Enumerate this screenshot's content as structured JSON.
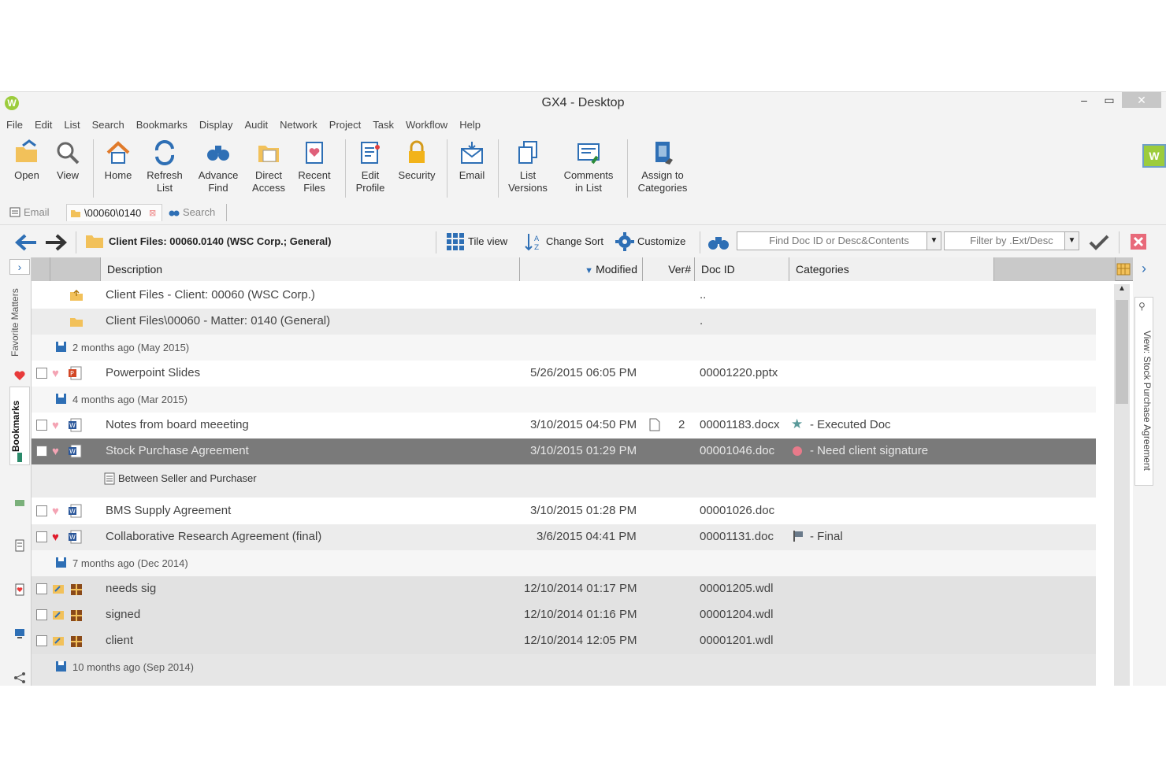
{
  "window": {
    "title": "GX4 - Desktop",
    "minimize": "‒",
    "maximize": "▭",
    "close": "✕"
  },
  "menu": [
    "File",
    "Edit",
    "List",
    "Search",
    "Bookmarks",
    "Display",
    "Audit",
    "Network",
    "Project",
    "Task",
    "Workflow",
    "Help"
  ],
  "ribbon": {
    "open": "Open",
    "view": "View",
    "home": "Home",
    "refresh_1": "Refresh",
    "refresh_2": "List",
    "advance_1": "Advance",
    "advance_2": "Find",
    "direct_1": "Direct",
    "direct_2": "Access",
    "recent_1": "Recent",
    "recent_2": "Files",
    "editprofile_1": "Edit",
    "editprofile_2": "Profile",
    "security": "Security",
    "email": "Email",
    "listversions_1": "List",
    "listversions_2": "Versions",
    "comments_1": "Comments",
    "comments_2": "in List",
    "assign_1": "Assign to",
    "assign_2": "Categories"
  },
  "tabs": {
    "email": "Email",
    "folder": "\\00060\\0140",
    "search": "Search"
  },
  "navbar": {
    "breadcrumb": "Client Files: 00060.0140 (WSC Corp.; General)",
    "tile_view": "Tile view",
    "change_sort": "Change Sort",
    "customize": "Customize",
    "find_placeholder": "Find Doc ID or Desc&Contents",
    "filter_placeholder": "Filter by .Ext/Desc"
  },
  "left_tabs": {
    "favorite": "Favorite Matters",
    "bookmarks": "Bookmarks"
  },
  "right_tab": "View: Stock Purchase Agreement",
  "columns": {
    "description": "Description",
    "modified": "Modified",
    "ver": "Ver#",
    "docid": "Doc ID",
    "categories": "Categories"
  },
  "rows": {
    "up1": {
      "desc": "Client Files - Client: 00060 (WSC Corp.)",
      "docid": ".."
    },
    "up2": {
      "desc": "Client Files\\00060 - Matter: 0140 (General)",
      "docid": "."
    },
    "g1": "2 months ago  (May 2015)",
    "r1": {
      "desc": "Powerpoint Slides",
      "modified": "5/26/2015 06:05 PM",
      "docid": "00001220.pptx"
    },
    "g2": "4 months ago  (Mar 2015)",
    "r2": {
      "desc": "Notes from board meeeting",
      "modified": "3/10/2015 04:50 PM",
      "ver": "2",
      "docid": "00001183.docx",
      "cat": "- Executed Doc"
    },
    "r3": {
      "desc": "Stock Purchase Agreement",
      "modified": "3/10/2015 01:29 PM",
      "docid": "00001046.doc",
      "cat": "- Need client signature",
      "sub": "Between Seller and Purchaser"
    },
    "r4": {
      "desc": "BMS Supply Agreement",
      "modified": "3/10/2015 01:28 PM",
      "docid": "00001026.doc"
    },
    "r5": {
      "desc": "Collaborative Research Agreement (final)",
      "modified": "3/6/2015 04:41 PM",
      "docid": "00001131.doc",
      "cat": "- Final"
    },
    "g3": "7 months ago  (Dec 2014)",
    "r6": {
      "desc": "needs sig",
      "modified": "12/10/2014 01:17 PM",
      "docid": "00001205.wdl"
    },
    "r7": {
      "desc": "signed",
      "modified": "12/10/2014 01:16 PM",
      "docid": "00001204.wdl"
    },
    "r8": {
      "desc": "client",
      "modified": "12/10/2014 12:05 PM",
      "docid": "00001201.wdl"
    },
    "g4": "10 months ago  (Sep 2014)"
  },
  "colors": {
    "accent": "#2e6fb5",
    "heart": "#e83a3a",
    "heart_light": "#f4a4b4",
    "selected": "#7a7a7a",
    "brand": "#9ccc3c"
  }
}
